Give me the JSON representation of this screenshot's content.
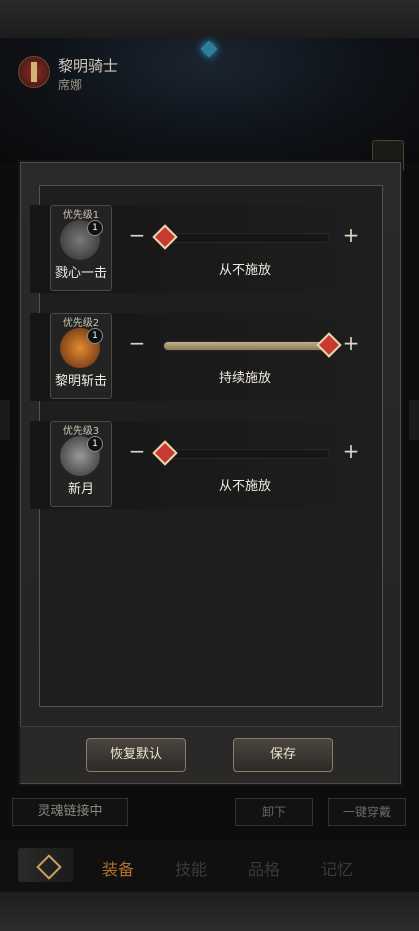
{
  "character": {
    "title": "黎明骑士",
    "name": "席娜"
  },
  "dialog": {
    "skills": [
      {
        "priority": "优先级1",
        "name": "戮心一击",
        "badge": "1",
        "status": "从不施放",
        "level": 0.0,
        "icon": "heart-shield-icon"
      },
      {
        "priority": "优先级2",
        "name": "黎明斩击",
        "badge": "1",
        "status": "持续施放",
        "level": 1.0,
        "icon": "crossed-swords-icon"
      },
      {
        "priority": "优先级3",
        "name": "新月",
        "badge": "1",
        "status": "从不施放",
        "level": 0.0,
        "icon": "crescent-slash-icon"
      }
    ],
    "minus_label": "−",
    "plus_label": "+",
    "restore_button": "恢复默认",
    "save_button": "保存"
  },
  "background_buttons": {
    "soul_link": "灵魂链接中",
    "unequip": "卸下",
    "equip_all": "一键穿戴"
  },
  "bottom_nav": {
    "tabs": [
      "装备",
      "技能",
      "品格",
      "记忆"
    ],
    "active_index": 0
  },
  "colors": {
    "accent": "#b0702a",
    "knob": "#c73a30",
    "fill": "#bfb08c"
  }
}
